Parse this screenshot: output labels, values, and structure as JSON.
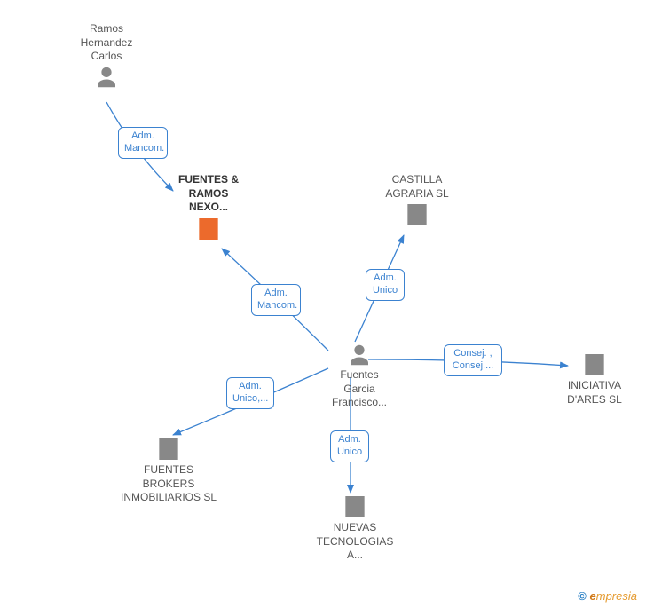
{
  "nodes": {
    "person1": {
      "label": "Ramos\nHernandez\nCarlos"
    },
    "person2": {
      "label": "Fuentes\nGarcia\nFrancisco..."
    },
    "company_highlight": {
      "label": "FUENTES &\nRAMOS\nNEXO..."
    },
    "company_castilla": {
      "label": "CASTILLA\nAGRARIA SL"
    },
    "company_iniciativa": {
      "label": "INICIATIVA\nD'ARES SL"
    },
    "company_nuevas": {
      "label": "NUEVAS\nTECNOLOGIAS\nA..."
    },
    "company_fuentes_brokers": {
      "label": "FUENTES\nBROKERS\nINMOBILIARIOS SL"
    }
  },
  "edges": {
    "e1": {
      "label": "Adm.\nMancom."
    },
    "e2": {
      "label": "Adm.\nMancom."
    },
    "e3": {
      "label": "Adm.\nUnico"
    },
    "e4": {
      "label": "Consej. ,\nConsej...."
    },
    "e5": {
      "label": "Adm.\nUnico"
    },
    "e6": {
      "label": "Adm.\nUnico,..."
    }
  },
  "watermark": {
    "copyright": "©",
    "brand_cap": "e",
    "brand_rest": "mpresia"
  },
  "colors": {
    "person_icon": "#888888",
    "company_icon": "#888888",
    "company_highlight": "#ec6a2c",
    "edge": "#3b82d0"
  }
}
